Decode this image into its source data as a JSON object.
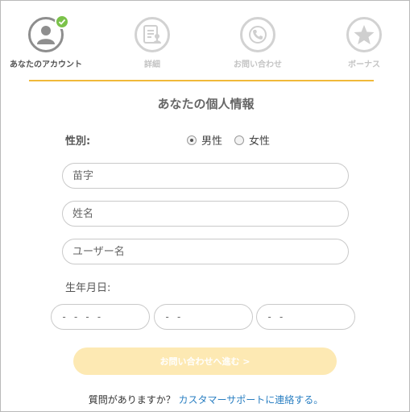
{
  "steps": [
    {
      "label": "あなたのアカウント",
      "icon": "user-icon",
      "state": "active",
      "completed": true
    },
    {
      "label": "詳細",
      "icon": "document-user-icon",
      "state": "inactive"
    },
    {
      "label": "お問い合わせ",
      "icon": "phone-icon",
      "state": "inactive"
    },
    {
      "label": "ボーナス",
      "icon": "star-icon",
      "state": "inactive"
    }
  ],
  "colors": {
    "accent": "#f0b93a",
    "check": "#7bc24a",
    "button_disabled": "#fde9b3",
    "link": "#2a7fc2"
  },
  "form": {
    "title": "あなたの個人情報",
    "gender_label": "性別:",
    "gender_options": [
      {
        "label": "男性",
        "selected": true
      },
      {
        "label": "女性",
        "selected": false
      }
    ],
    "last_name_placeholder": "苗字",
    "first_name_placeholder": "姓名",
    "username_placeholder": "ユーザー名",
    "dob_label": "生年月日:",
    "dob_year_placeholder": "- - - -",
    "dob_month_placeholder": "- -",
    "dob_day_placeholder": "- -",
    "submit_label": "お問い合わせへ進む >"
  },
  "footer": {
    "question": "質問がありますか？",
    "link_text": "カスタマーサポートに連絡する。"
  }
}
